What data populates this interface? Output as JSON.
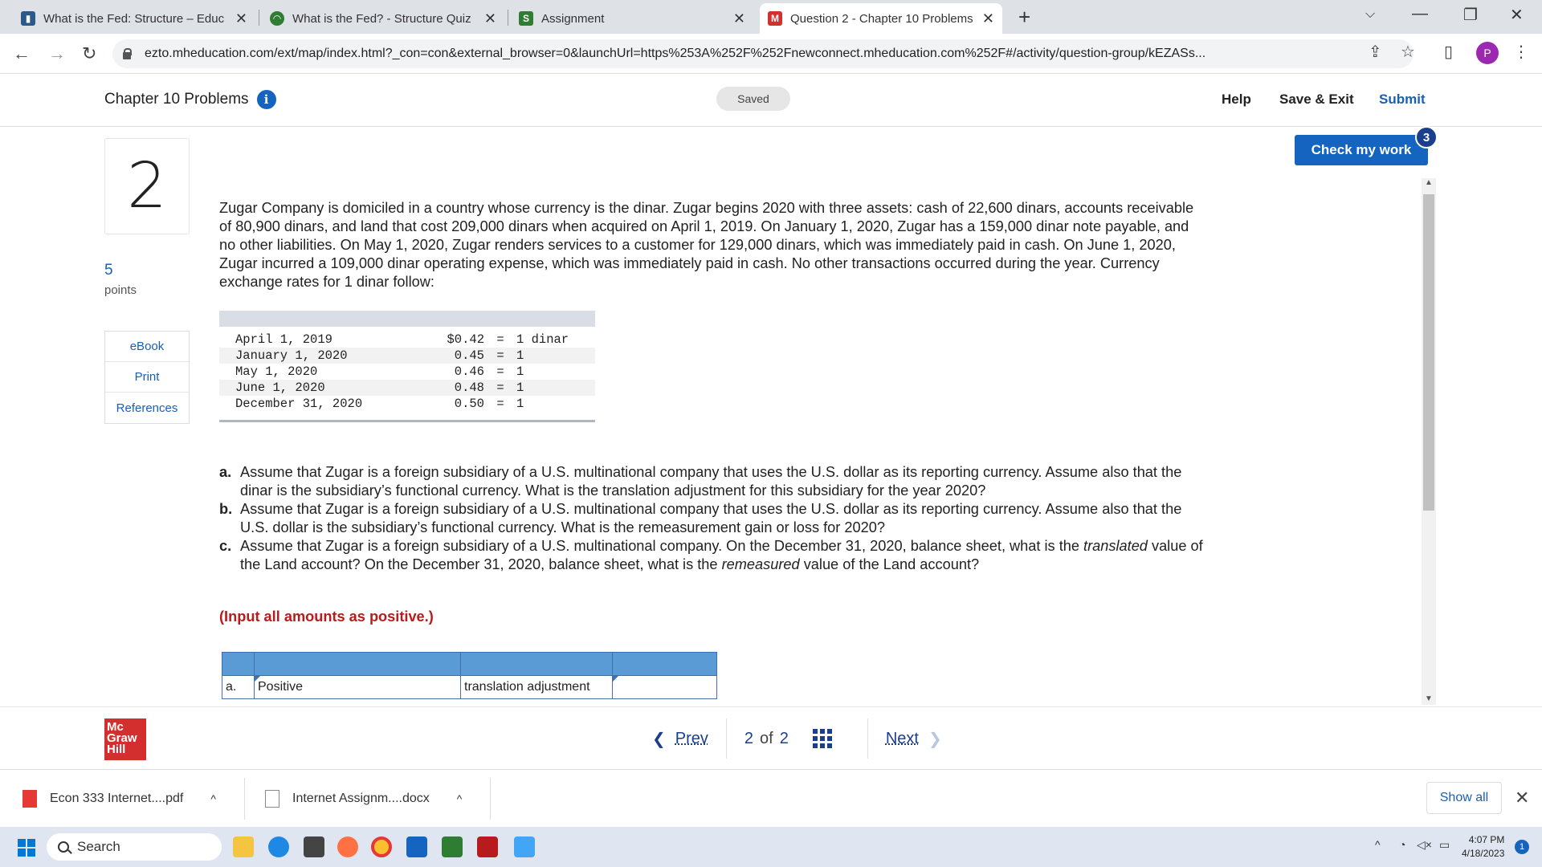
{
  "browser": {
    "tabs": [
      {
        "title": "What is the Fed: Structure – Educ",
        "favicon": "edu-favicon",
        "fav_color": "#2b5a8a"
      },
      {
        "title": "What is the Fed? - Structure Quiz",
        "favicon": "quiz-favicon",
        "fav_color": "#2e7d32"
      },
      {
        "title": "Assignment",
        "favicon": "s-favicon",
        "fav_color": "#2e7d32",
        "fav_text": "S"
      },
      {
        "title": "Question 2 - Chapter 10 Problems",
        "favicon": "mh-favicon",
        "fav_color": "#d32f2f",
        "fav_text": "M"
      }
    ],
    "url": "ezto.mheducation.com/ext/map/index.html?_con=con&external_browser=0&launchUrl=https%253A%252F%252Fnewconnect.mheducation.com%252F#/activity/question-group/kEZASs...",
    "profile_initial": "P"
  },
  "header": {
    "title": "Chapter 10 Problems",
    "info": "i",
    "status": "Saved",
    "help": "Help",
    "save_exit": "Save & Exit",
    "submit": "Submit"
  },
  "check": {
    "label": "Check my work",
    "badge": "3"
  },
  "question": {
    "number": "2",
    "points": "5",
    "points_label": "points",
    "side_buttons": [
      "eBook",
      "Print",
      "References"
    ],
    "body": "Zugar Company is domiciled in a country whose currency is the dinar. Zugar begins 2020 with three assets: cash of 22,600 dinars, accounts receivable of 80,900 dinars, and land that cost 209,000 dinars when acquired on April 1, 2019. On January 1, 2020, Zugar has a 159,000 dinar note payable, and no other liabilities. On May 1, 2020, Zugar renders services to a customer for 129,000 dinars, which was immediately paid in cash. On June 1, 2020, Zugar incurred a 109,000 dinar operating expense, which was immediately paid in cash. No other transactions occurred during the year. Currency exchange rates for 1 dinar follow:",
    "rates": [
      {
        "date": "April 1, 2019",
        "value": "$0.42",
        "eq": "=",
        "unit": "1 dinar"
      },
      {
        "date": "January 1, 2020",
        "value": "0.45",
        "eq": "=",
        "unit": "1"
      },
      {
        "date": "May 1, 2020",
        "value": "0.46",
        "eq": "=",
        "unit": "1"
      },
      {
        "date": "June 1, 2020",
        "value": "0.48",
        "eq": "=",
        "unit": "1"
      },
      {
        "date": "December 31, 2020",
        "value": "0.50",
        "eq": "=",
        "unit": "1"
      }
    ],
    "part_a_label": "a.",
    "part_a_text": "Assume that Zugar is a foreign subsidiary of a U.S. multinational company that uses the U.S. dollar as its reporting currency. Assume also that the dinar is the subsidiary’s functional currency. What is the translation adjustment for this subsidiary for the year 2020?",
    "part_b_label": "b.",
    "part_b_text": "Assume that Zugar is a foreign subsidiary of a U.S. multinational company that uses the U.S. dollar as its reporting currency. Assume also that the U.S. dollar is the subsidiary’s functional currency. What is the remeasurement gain or loss for 2020?",
    "part_c_label": "c.",
    "part_c_pre": "Assume that Zugar is a foreign subsidiary of a U.S. multinational company. On the December 31, 2020, balance sheet, what is the ",
    "part_c_em1": "translated",
    "part_c_mid": " value of the Land account? On the December 31, 2020, balance sheet, what is the ",
    "part_c_em2": "remeasured",
    "part_c_post": " value of the Land account?",
    "instruction": "(Input all amounts as positive.)",
    "answer_row": {
      "label": "a.",
      "select1": "Positive",
      "text": "translation adjustment",
      "input": ""
    }
  },
  "footer": {
    "prev": "Prev",
    "page_current": "2",
    "page_of": "of",
    "page_total": "2",
    "next": "Next",
    "logo_lines": [
      "Mc",
      "Graw",
      "Hill"
    ]
  },
  "downloads": {
    "items": [
      "Econ 333 Internet....pdf",
      "Internet Assignm....docx"
    ],
    "show_all": "Show all"
  },
  "taskbar": {
    "search": "Search",
    "time": "4:07 PM",
    "date": "4/18/2023",
    "notif_count": "1"
  }
}
